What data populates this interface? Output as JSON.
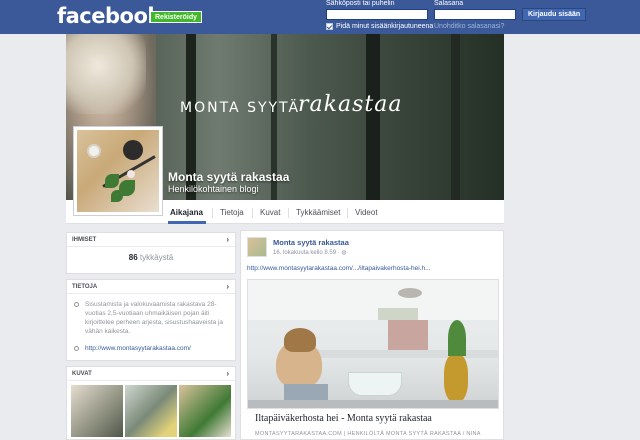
{
  "topbar": {
    "logo": "facebook",
    "signup_label": "Rekisteröidy",
    "email_label": "Sähköposti tai puhelin",
    "password_label": "Salasana",
    "login_button": "Kirjaudu sisään",
    "keep_logged_in": "Pidä minut sisäänkirjautuneena",
    "forgot_password": "Unohditko salasanasi?"
  },
  "cover": {
    "title_left": "MONTA SYYTÄ",
    "title_script": "rakastaa",
    "page_name": "Monta syytä rakastaa",
    "page_category": "Henkilökohtainen blogi"
  },
  "tabs": [
    {
      "label": "Aikajana",
      "active": true
    },
    {
      "label": "Tietoja"
    },
    {
      "label": "Kuvat"
    },
    {
      "label": "Tykkäämiset"
    },
    {
      "label": "Videot"
    }
  ],
  "sidebar": {
    "people": {
      "title": "IHMISET",
      "likes_count": "86",
      "likes_label": "tykkäystä"
    },
    "info": {
      "title": "TIETOJA",
      "description": "Sisustamista ja valokuvaamista rakastava 28-vuotias 2,5-vuotiaan uhmaikäisen pojan äiti kirjoittelee perheen arjesta, sisustushaaveista ja vähän kaikesta.",
      "website": "http://www.montasyytarakastaa.com/"
    },
    "photos": {
      "title": "KUVAT"
    }
  },
  "post": {
    "author": "Monta syytä rakastaa",
    "time": "16. lokakuuta kello 8.59 · ",
    "url": "http://www.montasyytarakastaa.com/.../iltapaivakerhosta-hei.h...",
    "link_title": "Iltapäiväkerhosta hei - Monta syytä rakastaa",
    "link_source": "MONTASYYTARAKASTAA.COM | HENKILÖLTÄ MONTA SYYTÄ RAKASTAA / NINA"
  },
  "colors": {
    "brand": "#3b5998",
    "signup": "#42b72a",
    "link": "#365899"
  }
}
